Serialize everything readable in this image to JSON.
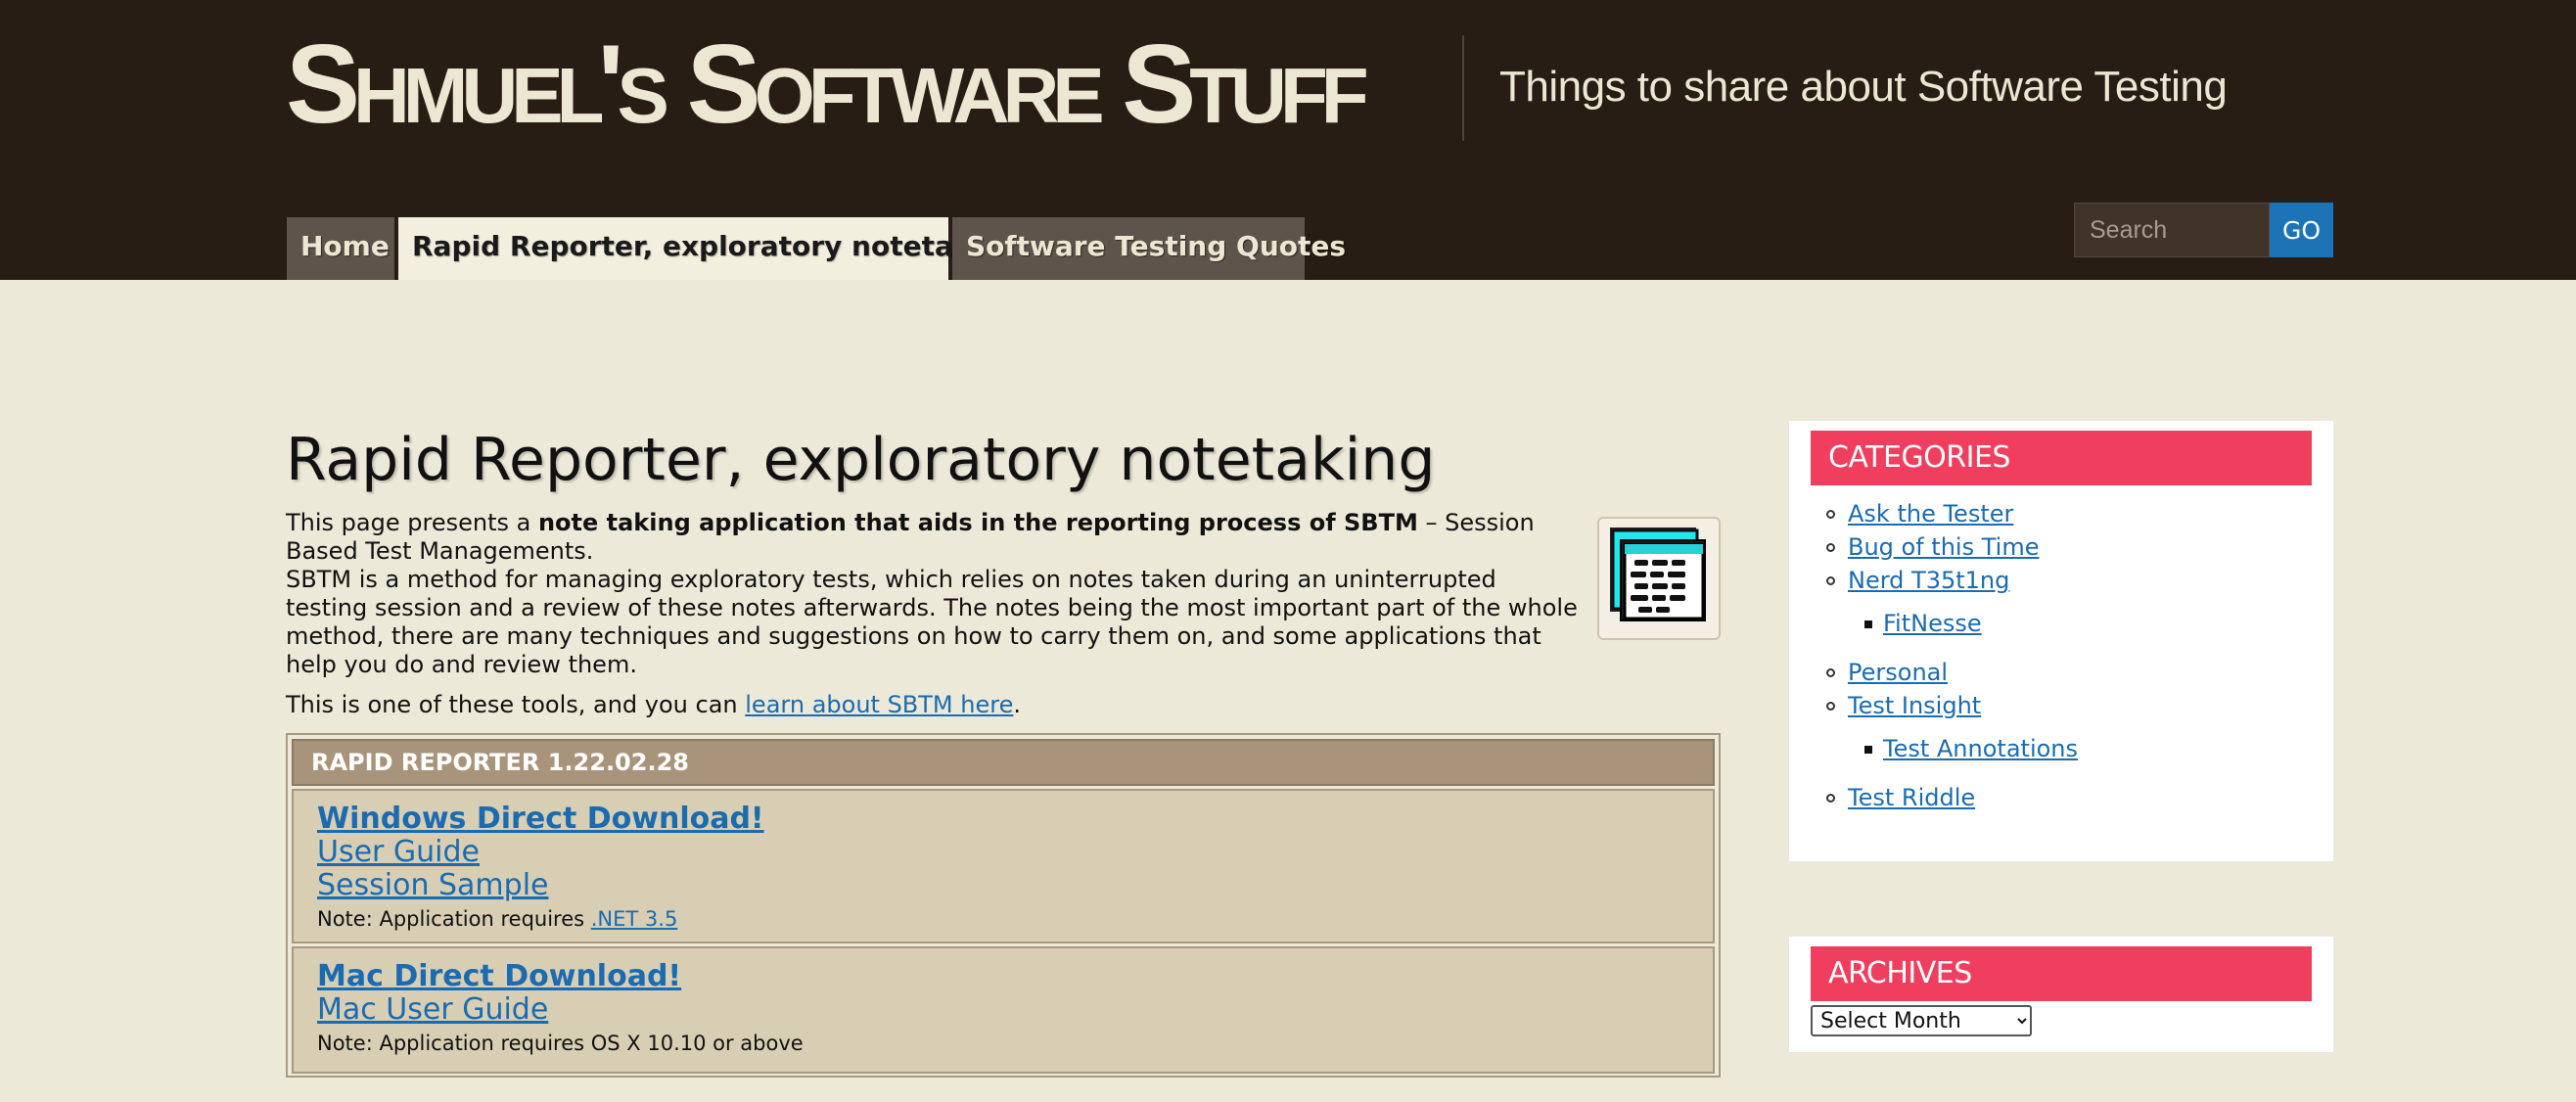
{
  "site": {
    "title": "Shmuel's Software Stuff",
    "tagline": "Things to share about Software Testing"
  },
  "nav": {
    "tabs": [
      {
        "label": "Home",
        "active": false
      },
      {
        "label": "Rapid Reporter, exploratory notetaking",
        "active": true
      },
      {
        "label": "Software Testing Quotes",
        "active": false
      }
    ]
  },
  "search": {
    "placeholder": "Search",
    "button_label": "GO"
  },
  "page": {
    "title": "Rapid Reporter, exploratory notetaking",
    "intro_start": "This page presents a ",
    "intro_bold": "note taking application that aids in the reporting process of SBTM",
    "intro_end": " – Session Based Test Managements.",
    "intro_p2": "SBTM is a method for managing exploratory tests, which relies on notes taken during an uninterrupted testing session and a review of these notes afterwards. The notes being the most important part of the whole method, there are many techniques and suggestions on how to carry them on, and some applications that help you do and review them.",
    "tools_text": "This is one of these tools, and you can ",
    "tools_link": "learn about SBTM here",
    "tools_end": "."
  },
  "download_box": {
    "header": "RAPID REPORTER 1.22.02.28",
    "windows": {
      "download": "Windows Direct Download!",
      "guide": "User Guide",
      "sample": "Session Sample",
      "note_prefix": "Note: Application requires ",
      "note_link": ".NET 3.5"
    },
    "mac": {
      "download": "Mac Direct Download!",
      "guide": "Mac User Guide",
      "note": "Note: Application requires OS X 10.10 or above"
    }
  },
  "sidebar": {
    "categories": {
      "title": "CATEGORIES",
      "items": [
        {
          "label": "Ask the Tester"
        },
        {
          "label": "Bug of this Time"
        },
        {
          "label": "Nerd T35t1ng"
        },
        {
          "label": "FitNesse"
        },
        {
          "label": "Personal"
        },
        {
          "label": "Test Insight"
        },
        {
          "label": "Test Annotations"
        },
        {
          "label": "Test Riddle"
        }
      ]
    },
    "archives": {
      "title": "ARCHIVES",
      "select_label": "Select Month"
    }
  },
  "colors": {
    "header_bg": "#271d15",
    "page_bg": "#ede9d8",
    "widget_title_bg": "#ef3e5e",
    "link": "#1a6bb0",
    "go_button": "#1c73b5"
  }
}
